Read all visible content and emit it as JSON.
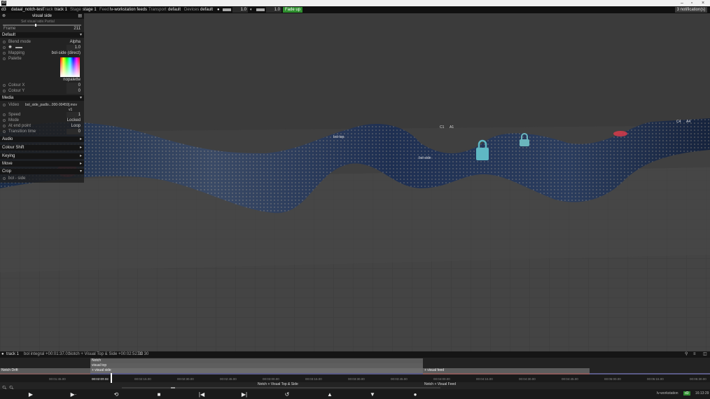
{
  "titlebar": {
    "app_icon": "d3",
    "min_icon": "minimize-icon",
    "max_icon": "maximize-icon",
    "close_icon": "close-icon"
  },
  "appbar": {
    "app": "d3",
    "project": "dataal_notch-test",
    "track_label": "Track",
    "track_value": "track 1",
    "stage_label": "Stage",
    "stage_value": "stage 1",
    "feed_label": "Feed",
    "feed_value": "lv-workstation feeds",
    "transport_label": "Transport",
    "transport_value": "default",
    "devices_label": "Devices",
    "devices_value": "default",
    "volume_value": "1.0",
    "brightness_value": "1.0",
    "fade_up_label": "Fade up",
    "notifications_label": "3 notification(s)"
  },
  "panel": {
    "title": "visual side",
    "subtitle": "Set visual side.Partial",
    "frame_label": "Frame",
    "frame_value": "211",
    "default_section": "Default",
    "blend_mode_label": "Blend mode",
    "blend_mode_value": "Alpha",
    "brightness_value": "1.0",
    "mapping_label": "Mapping",
    "mapping_value": "bol-side (direct)",
    "palette_label": "Palette",
    "palette_value": "nopalette",
    "colour_x_label": "Colour X",
    "colour_x_value": "0",
    "colour_y_label": "Colour Y",
    "colour_y_value": "0",
    "media_section": "Media",
    "video_label": "Video",
    "video_value": "bol_side_padlo...000-00459].mov",
    "video_version": "v1",
    "speed_label": "Speed",
    "speed_value": "1",
    "mode_label": "Mode",
    "mode_value": "Locked",
    "at_end_point_label": "At end point",
    "at_end_point_value": "Loop",
    "transition_time_label": "Transition time",
    "transition_time_value": "0",
    "sections": [
      "Audio",
      "Colour Shift",
      "Keying",
      "Move",
      "Crop"
    ],
    "crop_value": "bol - side"
  },
  "viewport": {
    "label_bol_top": "bol-top",
    "label_bol_side": "bol-side",
    "label_c1": "C1",
    "label_a1": "A1",
    "label_c4": "C4",
    "label_a4": "A4"
  },
  "timeline": {
    "track_name": "track 1",
    "cue_info": "bol integral +00:01:37.01",
    "notch_info": "Notch + Visual Top & Side +00:02:52.28",
    "tc_info": "TC 30",
    "clip_notch_drift": "Notch Drift",
    "clip_notch": "Notch",
    "clip_visual_top": "visual top",
    "clip_visual_side": "+ visual side",
    "clip_visual_feed": "+ visual feed",
    "section_label_1": "Notch + Visual Top & Side",
    "section_label_2": "Notch + Visual Feed",
    "ticks": [
      "00:01:45.00",
      "00:02:00.00",
      "00:02:15.00",
      "00:02:30.00",
      "00:02:45.00",
      "00:03:00.00",
      "00:03:15.00",
      "00:03:30.00",
      "00:03:45.00",
      "00:04:00.00",
      "00:04:15.00",
      "00:04:30.00",
      "00:04:45.00",
      "00:05:00.00",
      "00:05:15.00",
      "00:05:30.00"
    ],
    "current_time": "00:02:07.02"
  },
  "statusbar": {
    "machine": "lv-workstation",
    "badge": "d3",
    "clock": "16:13:29"
  }
}
